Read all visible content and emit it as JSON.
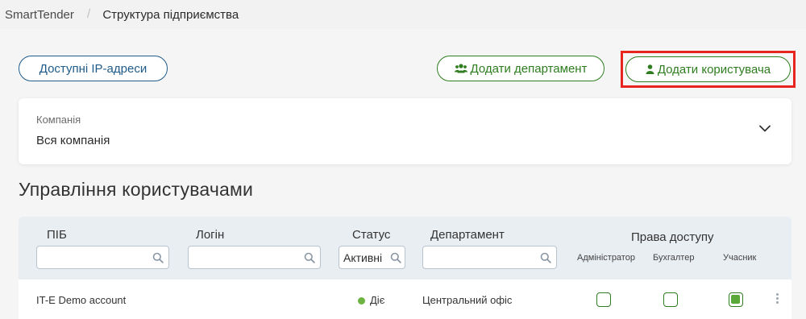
{
  "breadcrumb": {
    "root": "SmartTender",
    "separator": "/",
    "current": "Структура підприємства"
  },
  "actions": {
    "ip_label": "Доступні IP-адреси",
    "dept_label": "Додати департамент",
    "user_label": "Додати користувача"
  },
  "company": {
    "label": "Компанія",
    "value": "Вся компанія"
  },
  "section_title": "Управління користувачами",
  "table": {
    "col_name": "ПІБ",
    "col_login": "Логін",
    "col_status": "Статус",
    "col_department": "Департамент",
    "col_rights": "Права доступу",
    "rights": [
      "Адміністратор",
      "Бухгалтер",
      "Учасник"
    ],
    "filters": {
      "name": "",
      "login": "",
      "status": "Активні",
      "department": ""
    },
    "rows": [
      {
        "name": "IT-E Demo account",
        "status": "Діє",
        "department": "Центральний офіс",
        "admin": false,
        "accountant": false,
        "participant": true
      }
    ]
  },
  "colors": {
    "brand_blue": "#1f5b8a",
    "brand_green": "#2e7d1f",
    "highlight_red": "#e8241e",
    "status_active": "#6cb33f"
  }
}
